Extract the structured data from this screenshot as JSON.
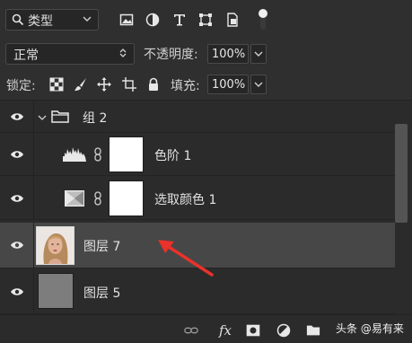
{
  "filter": {
    "kind_label": "类型"
  },
  "blend": {
    "mode": "正常",
    "opacity_label": "不透明度:",
    "opacity_value": "100%"
  },
  "lock": {
    "label": "锁定:",
    "fill_label": "填充:",
    "fill_value": "100%"
  },
  "layers": [
    {
      "name": "组 2",
      "type": "group",
      "visible": true
    },
    {
      "name": "色阶 1",
      "type": "adjustment-levels",
      "visible": true
    },
    {
      "name": "选取颜色 1",
      "type": "adjustment-selective-color",
      "visible": true
    },
    {
      "name": "图层 7",
      "type": "pixel",
      "visible": true,
      "selected": true
    },
    {
      "name": "图层 5",
      "type": "pixel",
      "visible": true
    }
  ],
  "footer": {
    "fx_label": "fx",
    "watermark": "头条 @易有来"
  },
  "colors": {
    "panel_bg": "#2b2b2b",
    "selected_row": "#474747",
    "arrow": "#e8322a"
  }
}
